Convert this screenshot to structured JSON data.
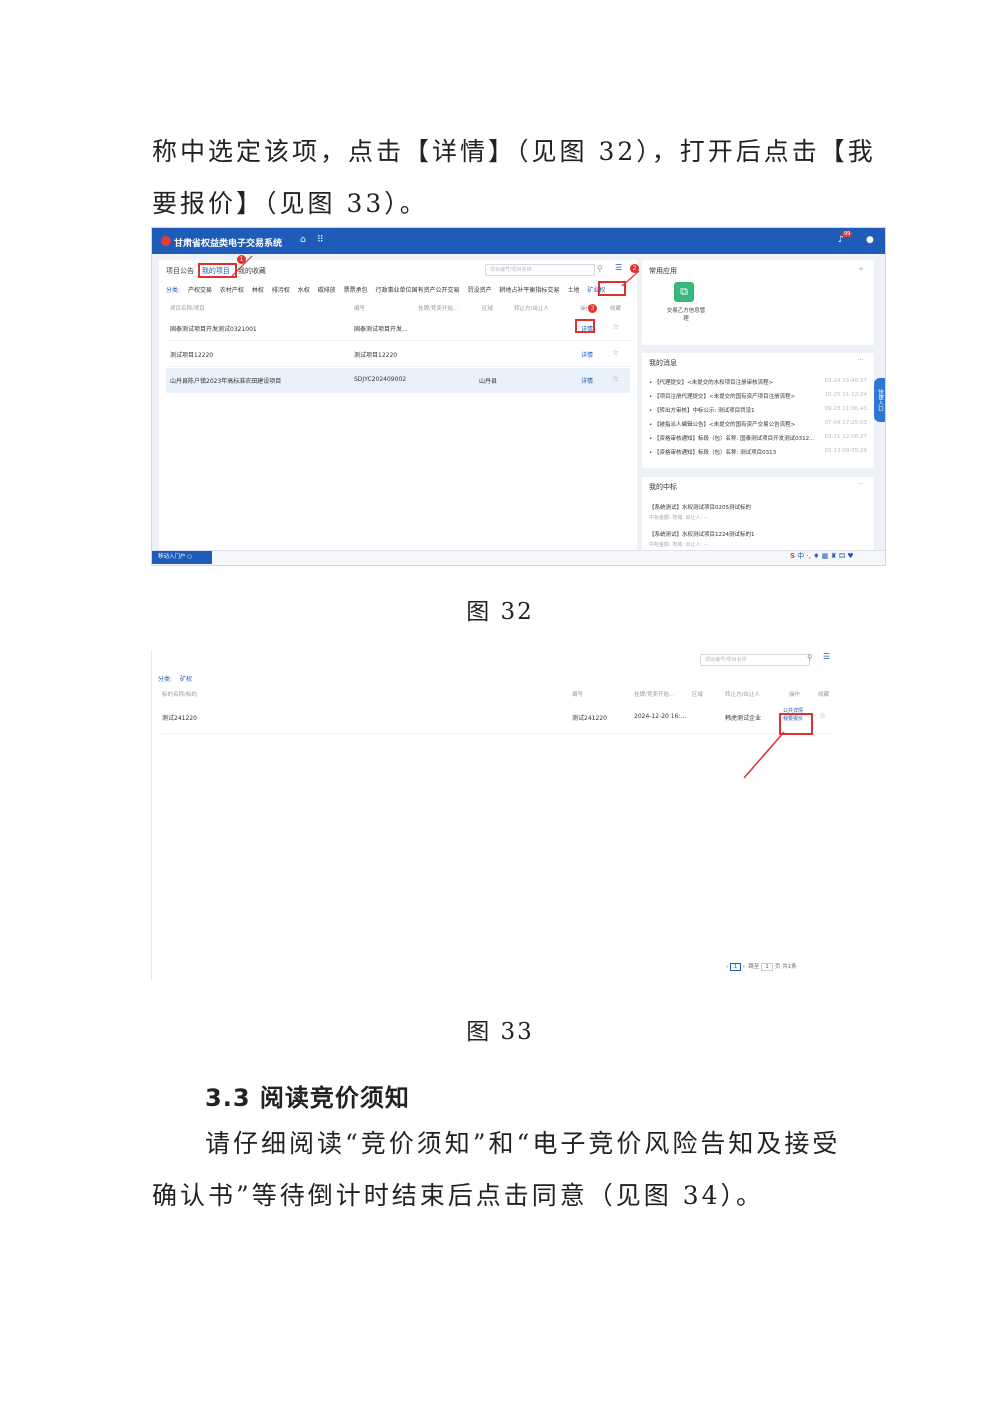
{
  "intro": {
    "line1": "称中选定该项，点击【详情】（见图 32），打开后点击【我",
    "line2": "要报价】（见图 33）。"
  },
  "fig32": {
    "system_title": "甘肃省权益类电子交易系统",
    "badge_count": "99",
    "tabs": [
      "项目公告",
      "我的项目",
      "我的收藏"
    ],
    "search_placeholder": "项目编号/项目名称",
    "category_label": "分类:",
    "categories": [
      "产权交易",
      "农村产权",
      "林权",
      "排污权",
      "水权",
      "碳排放",
      "票票承包",
      "行政事业单位国有资产公开交易",
      "罚没资产",
      "耕地占补平衡指标交易",
      "土地",
      "矿业权"
    ],
    "headers": [
      "项目名称/项目",
      "编号",
      "挂牌/竞卖开始...",
      "区域",
      "转让方/出让人",
      "操作",
      "收藏"
    ],
    "rows": [
      {
        "name": "国泰测试项目开发测试0321001",
        "code": "国泰测试项目开发...",
        "region": "",
        "action": "详情"
      },
      {
        "name": "测试项目12220",
        "code": "测试项目12220",
        "region": "",
        "action": "详情"
      },
      {
        "name": "山丹县陈户镇2023年高标准农田建设项目",
        "code": "SDJYC202409002",
        "region": "山丹县",
        "action": "详情"
      }
    ],
    "markers": [
      "1",
      "2",
      "3"
    ],
    "common_apps_title": "常用应用",
    "app_label": "交易乙方信息管理",
    "messages_title": "我的消息",
    "messages": [
      {
        "text": "【代理提交】<未提交的水权项目注册审核流程>",
        "time": "03-24 15:40:37"
      },
      {
        "text": "【项目注册代理提交】<未提交的国有资产项目注册流程>",
        "time": "10-25 11:12:24"
      },
      {
        "text": "【转出方审核】中标公示: 测试项目罚没1",
        "time": "09-23 11:06:43"
      },
      {
        "text": "【被指派人编辑公告】<未提交的国有资产交易公告流程>",
        "time": "07-04 17:25:03"
      },
      {
        "text": "【资格审核通知】标段（包）名称: 国泰测试项目开发测试0312...",
        "time": "03-21 12:06:27"
      },
      {
        "text": "【资格审核通知】标段（包）名称: 测试项目0313",
        "time": "03-13 09:35:29"
      }
    ],
    "wins_title": "我的中标",
    "wins": [
      {
        "title": "【系统测试】水权测试项目0205测试标的",
        "meta": "中标金额:        地域:        出让人: --"
      },
      {
        "title": "【系统测试】水权测试项目1224测试标的1",
        "meta": "中标金额:        地域:        出让人: --"
      }
    ],
    "portal_button": "移动入门户 ○",
    "side_tab": "快捷入口",
    "more": "···",
    "plus": "+",
    "tray": "中 ·, ♦ ▦ ♜ ⚃ ♥"
  },
  "caption32": "图 32",
  "fig33": {
    "search_placeholder": "项目编号/项目名称",
    "category_label": "分类:",
    "category_value": "矿权",
    "headers": [
      "标的名称/标的",
      "编号",
      "挂牌/竞卖开始...",
      "区域",
      "转让方/出让人",
      "操作",
      "收藏"
    ],
    "row": {
      "name": "测试241220",
      "code": "测试241220",
      "date": "2024-12-20 16:...",
      "transferor": "韩虎测试企业",
      "action1": "公共详情",
      "action2": "我要报价"
    },
    "pager": {
      "prev": "‹",
      "page": "1",
      "next": "›",
      "goto": "跳至",
      "page_input": "1",
      "page_unit": "页",
      "total": "共1条"
    }
  },
  "caption33": "图 33",
  "section": {
    "heading": "3.3 阅读竞价须知",
    "line1": "请仔细阅读“竞价须知”和“电子竞价风险告知及接受",
    "line2": "确认书”等待倒计时结束后点击同意（见图 34）。"
  }
}
